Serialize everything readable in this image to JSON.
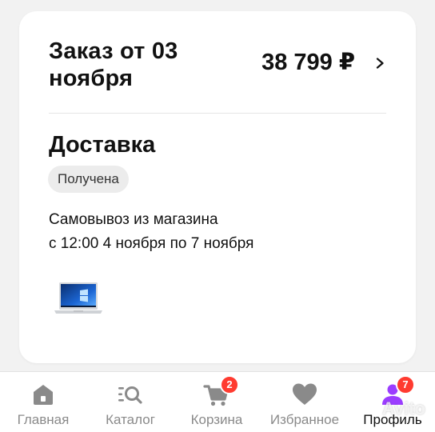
{
  "order": {
    "title": "Заказ от 03 ноября",
    "total": "38 799 ₽",
    "chevron_icon": "chevron-right-icon"
  },
  "delivery": {
    "title": "Доставка",
    "status": "Получена",
    "pickup_line1": "Самовывоз из магазина",
    "pickup_line2": "с 12:00 4 ноября по 7 ноября",
    "item_image": "laptop-thumbnail"
  },
  "nav": {
    "items": [
      {
        "label": "Главная",
        "icon": "home-icon"
      },
      {
        "label": "Каталог",
        "icon": "catalog-search-icon"
      },
      {
        "label": "Корзина",
        "icon": "cart-icon",
        "badge": "2"
      },
      {
        "label": "Избранное",
        "icon": "heart-icon"
      },
      {
        "label": "Профиль",
        "icon": "profile-icon",
        "badge": "7",
        "active": true
      }
    ]
  },
  "watermark": "Avito",
  "colors": {
    "background": "#f2f2f2",
    "card": "#ffffff",
    "badge_red": "#ff3b30",
    "profile_purple": "#9b3dff",
    "icon_gray": "#8a8a8a"
  }
}
